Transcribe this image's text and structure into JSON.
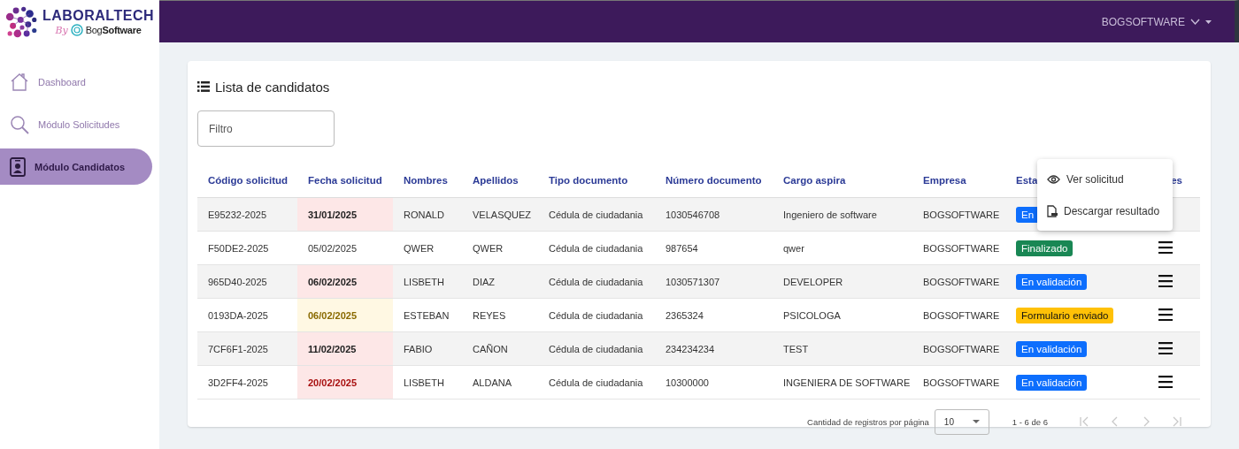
{
  "brand": {
    "name": "LABORALTECH",
    "by": "By",
    "partner": "Bog**Software**"
  },
  "sidebar": {
    "items": [
      {
        "label": "Dashboard",
        "kind": "home",
        "selected": false
      },
      {
        "label": "Módulo Solicitudes",
        "kind": "search",
        "selected": false
      },
      {
        "label": "Módulo Candidatos",
        "kind": "badge",
        "selected": true
      }
    ]
  },
  "topbar": {
    "user": "BOGSOFTWARE"
  },
  "card": {
    "title": "Lista de candidatos",
    "filter": {
      "placeholder": "Filtro"
    }
  },
  "table": {
    "columns": [
      "Código solicitud",
      "Fecha solicitud",
      "Nombres",
      "Apellidos",
      "Tipo documento",
      "Número documento",
      "Cargo aspira",
      "Empresa",
      "Esta",
      "es"
    ],
    "rows": [
      {
        "code": "E95232-2025",
        "date": "31/01/2025",
        "kind": "late",
        "names": "RONALD",
        "surnames": "VELASQUEZ",
        "doc_type": "Cédula de ciudadania",
        "doc_number": "1030546708",
        "position": "Ingeniero de software",
        "company": "BOGSOFTWARE",
        "status": "En",
        "color": "#0d6efd",
        "menu_open": true
      },
      {
        "code": "F50DE2-2025",
        "date": "05/02/2025",
        "kind": "normal",
        "names": "QWER",
        "surnames": "QWER",
        "doc_type": "Cédula de ciudadania",
        "doc_number": "987654",
        "position": "qwer",
        "company": "BOGSOFTWARE",
        "status": "Finalizado",
        "color": "#198754",
        "menu_open": false
      },
      {
        "code": "965D40-2025",
        "date": "06/02/2025",
        "kind": "late",
        "names": "LISBETH",
        "surnames": "DIAZ",
        "doc_type": "Cédula de ciudadania",
        "doc_number": "1030571307",
        "position": "DEVELOPER",
        "company": "BOGSOFTWARE",
        "status": "En validación",
        "color": "#0d6efd",
        "menu_open": false
      },
      {
        "code": "0193DA-2025",
        "date": "06/02/2025",
        "kind": "warning",
        "names": "ESTEBAN",
        "surnames": "REYES",
        "doc_type": "Cédula de ciudadania",
        "doc_number": "2365324",
        "position": "PSICOLOGA",
        "company": "BOGSOFTWARE",
        "status": "Formulario enviado",
        "color": "#ffc107",
        "menu_open": false
      },
      {
        "code": "7CF6F1-2025",
        "date": "11/02/2025",
        "kind": "late",
        "names": "FABIO",
        "surnames": "CAÑON",
        "doc_type": "Cédula de ciudadania",
        "doc_number": "234234234",
        "position": "TEST",
        "company": "BOGSOFTWARE",
        "status": "En validación",
        "color": "#0d6efd",
        "menu_open": false
      },
      {
        "code": "3D2FF4-2025",
        "date": "20/02/2025",
        "kind": "critical",
        "names": "LISBETH",
        "surnames": "ALDANA",
        "doc_type": "Cédula de ciudadania",
        "doc_number": "10300000",
        "position": "INGENIERA DE SOFTWARE",
        "company": "BOGSOFTWARE",
        "status": "En validación",
        "color": "#0d6efd",
        "menu_open": false
      }
    ]
  },
  "row_menu": {
    "items": [
      {
        "label": "Ver solicitud",
        "kind": "view"
      },
      {
        "label": "Descargar resultado",
        "kind": "download"
      }
    ]
  },
  "paginator": {
    "label": "Cantidad de registros por página",
    "page_size": "10",
    "range": "1 - 6 de 6",
    "buttons": [
      {
        "kind": "first",
        "disabled": true
      },
      {
        "kind": "prev",
        "disabled": true
      },
      {
        "kind": "next",
        "disabled": true
      },
      {
        "kind": "last",
        "disabled": true
      }
    ]
  }
}
